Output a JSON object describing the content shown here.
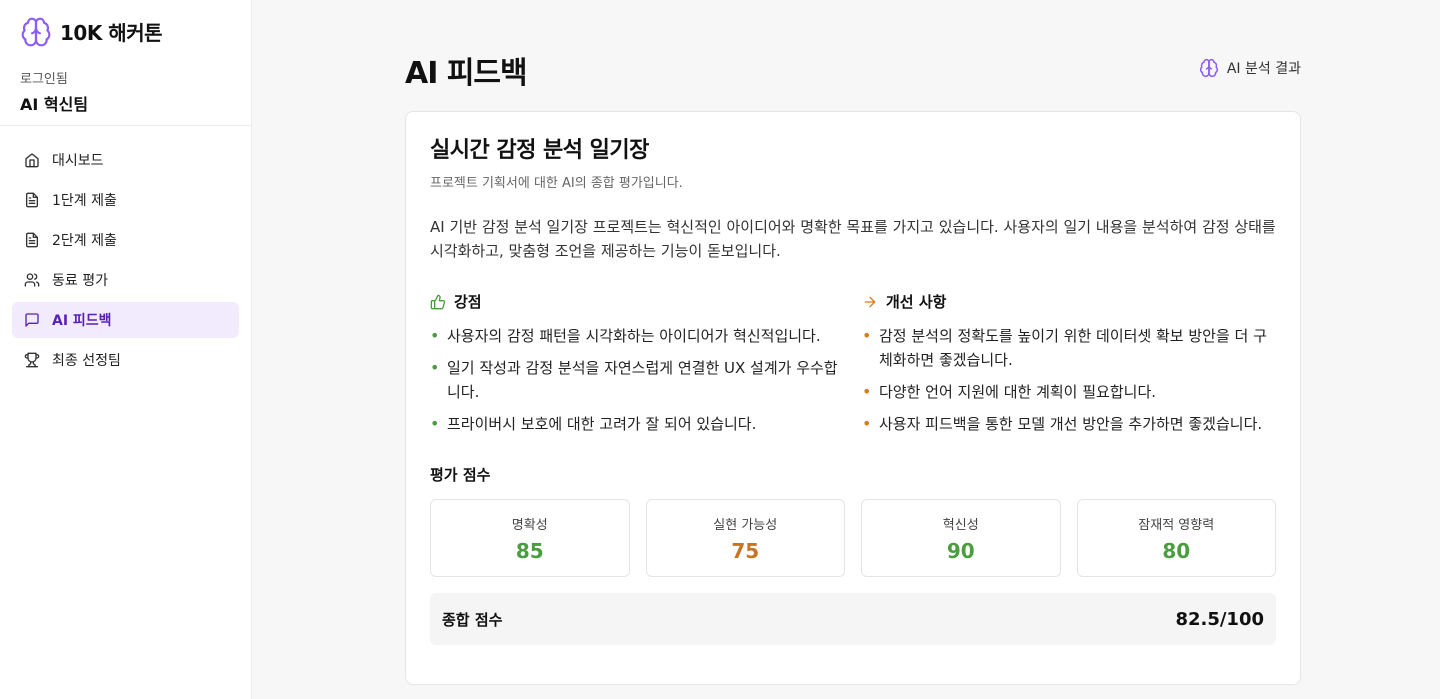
{
  "brand": {
    "name": "10K 해커톤",
    "accent": "#8b5cf6"
  },
  "user": {
    "login_label": "로그인됨",
    "team": "AI 혁신팀"
  },
  "nav": {
    "items": [
      {
        "label": "대시보드",
        "icon": "home-icon"
      },
      {
        "label": "1단계 제출",
        "icon": "file-icon"
      },
      {
        "label": "2단계 제출",
        "icon": "file-icon"
      },
      {
        "label": "동료 평가",
        "icon": "users-icon"
      },
      {
        "label": "AI 피드백",
        "icon": "message-icon",
        "active": true
      },
      {
        "label": "최종 선정팀",
        "icon": "trophy-icon"
      }
    ]
  },
  "page": {
    "title": "AI 피드백",
    "ai_result_label": "AI 분석 결과"
  },
  "feedback": {
    "project_title": "실시간 감정 분석 일기장",
    "subtitle": "프로젝트 기획서에 대한 AI의 종합 평가입니다.",
    "summary": "AI 기반 감정 분석 일기장 프로젝트는 혁신적인 아이디어와 명확한 목표를 가지고 있습니다. 사용자의 일기 내용을 분석하여 감정 상태를 시각화하고, 맞춤형 조언을 제공하는 기능이 돋보입니다.",
    "strengths": {
      "title": "강점",
      "items": [
        "사용자의 감정 패턴을 시각화하는 아이디어가 혁신적입니다.",
        "일기 작성과 감정 분석을 자연스럽게 연결한 UX 설계가 우수합니다.",
        "프라이버시 보호에 대한 고려가 잘 되어 있습니다."
      ]
    },
    "improvements": {
      "title": "개선 사항",
      "items": [
        "감정 분석의 정확도를 높이기 위한 데이터셋 확보 방안을 더 구체화하면 좋겠습니다.",
        "다양한 언어 지원에 대한 계획이 필요합니다.",
        "사용자 피드백을 통한 모델 개선 방안을 추가하면 좋겠습니다."
      ]
    },
    "scores_title": "평가 점수",
    "scores": [
      {
        "label": "명확성",
        "value": "85",
        "color": "#4a9e3f"
      },
      {
        "label": "실현 가능성",
        "value": "75",
        "color": "#c87420"
      },
      {
        "label": "혁신성",
        "value": "90",
        "color": "#4a9e3f"
      },
      {
        "label": "잠재적 영향력",
        "value": "80",
        "color": "#4a9e3f"
      }
    ],
    "total_label": "종합 점수",
    "total_value": "82.5/100"
  }
}
